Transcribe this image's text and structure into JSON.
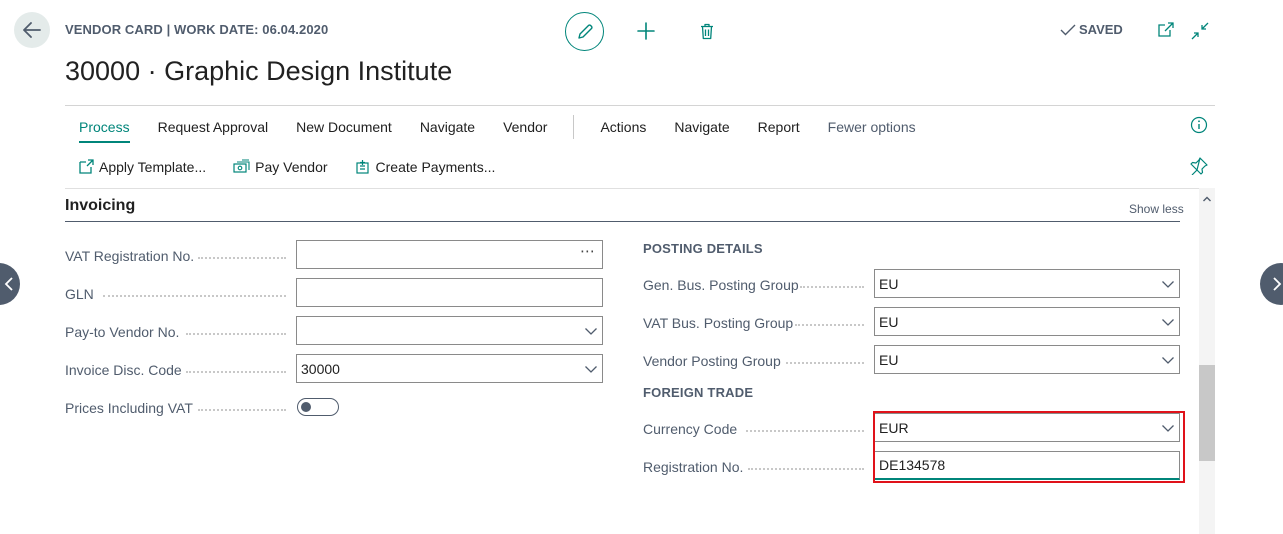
{
  "header": {
    "breadcrumb": "VENDOR CARD | WORK DATE: 06.04.2020",
    "title": "30000 · Graphic Design Institute",
    "status": "SAVED"
  },
  "menu": {
    "primary": [
      "Process",
      "Request Approval",
      "New Document",
      "Navigate",
      "Vendor"
    ],
    "secondary": [
      "Actions",
      "Navigate",
      "Report"
    ],
    "fewer_options": "Fewer options",
    "sub_actions": [
      "Apply Template...",
      "Pay Vendor",
      "Create Payments..."
    ]
  },
  "section": {
    "title": "Invoicing",
    "toggle_label": "Show less"
  },
  "left_fields": [
    {
      "label": "VAT Registration No.",
      "value": "",
      "control": "lookup"
    },
    {
      "label": "GLN",
      "value": "",
      "control": "text"
    },
    {
      "label": "Pay-to Vendor No.",
      "value": "",
      "control": "dropdown"
    },
    {
      "label": "Invoice Disc. Code",
      "value": "30000",
      "control": "dropdown"
    },
    {
      "label": "Prices Including VAT",
      "value": "",
      "control": "toggle"
    }
  ],
  "posting_details": {
    "title": "POSTING DETAILS",
    "fields": [
      {
        "label": "Gen. Bus. Posting Group",
        "value": "EU"
      },
      {
        "label": "VAT Bus. Posting Group",
        "value": "EU"
      },
      {
        "label": "Vendor Posting Group",
        "value": "EU"
      }
    ]
  },
  "foreign_trade": {
    "title": "FOREIGN TRADE",
    "fields": [
      {
        "label": "Currency Code",
        "value": "EUR"
      },
      {
        "label": "Registration No.",
        "value": "DE134578"
      }
    ]
  },
  "colors": {
    "accent": "#00857a",
    "highlight": "#e0121a",
    "label": "#505c6d"
  },
  "icons": [
    "back-arrow-icon",
    "pencil-icon",
    "plus-icon",
    "trash-icon",
    "check-icon",
    "popout-icon",
    "collapse-icon",
    "info-icon",
    "pin-icon",
    "chevron-down-icon",
    "chevron-left-icon",
    "chevron-right-icon"
  ]
}
